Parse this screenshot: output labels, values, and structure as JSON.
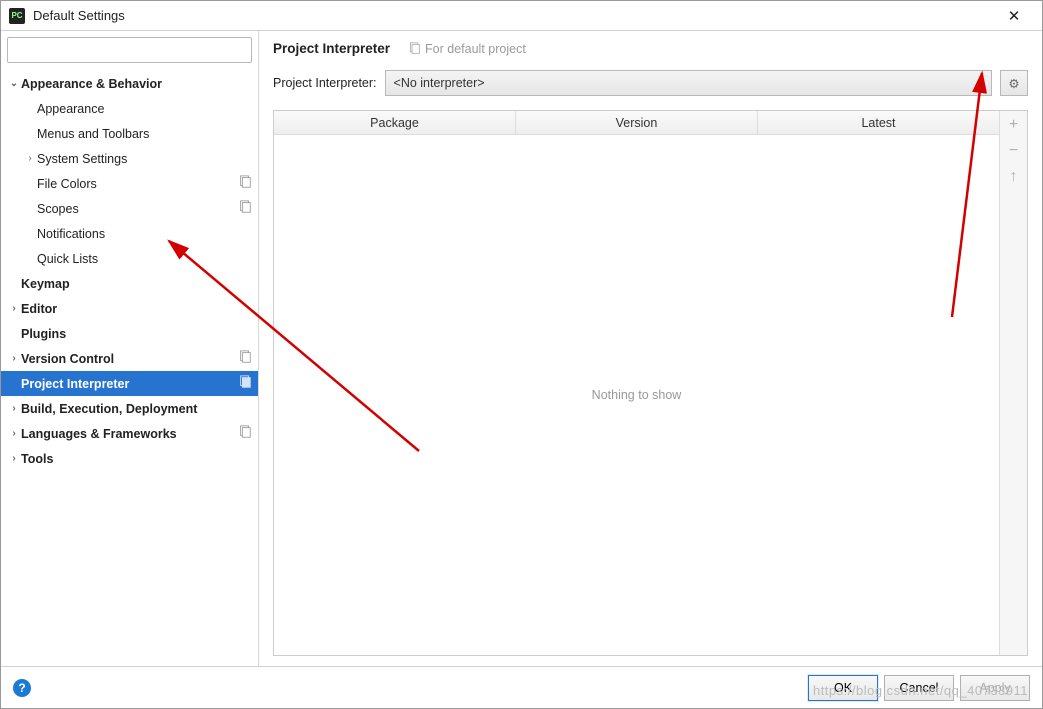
{
  "window": {
    "title": "Default Settings",
    "app_icon_text": "PC"
  },
  "search": {
    "placeholder": ""
  },
  "tree": [
    {
      "label": "Appearance & Behavior",
      "indent": 1,
      "bold": true,
      "chev": "open"
    },
    {
      "label": "Appearance",
      "indent": 2
    },
    {
      "label": "Menus and Toolbars",
      "indent": 2
    },
    {
      "label": "System Settings",
      "indent": 2,
      "chev": "closed"
    },
    {
      "label": "File Colors",
      "indent": 2,
      "copy": true
    },
    {
      "label": "Scopes",
      "indent": 2,
      "copy": true
    },
    {
      "label": "Notifications",
      "indent": 2
    },
    {
      "label": "Quick Lists",
      "indent": 2
    },
    {
      "label": "Keymap",
      "indent": 1,
      "bold": true
    },
    {
      "label": "Editor",
      "indent": 1,
      "bold": true,
      "chev": "closed"
    },
    {
      "label": "Plugins",
      "indent": 1,
      "bold": true
    },
    {
      "label": "Version Control",
      "indent": 1,
      "bold": true,
      "chev": "closed",
      "copy": true
    },
    {
      "label": "Project Interpreter",
      "indent": 1,
      "bold": true,
      "selected": true,
      "copy": true
    },
    {
      "label": "Build, Execution, Deployment",
      "indent": 1,
      "bold": true,
      "chev": "closed"
    },
    {
      "label": "Languages & Frameworks",
      "indent": 1,
      "bold": true,
      "chev": "closed",
      "copy": true
    },
    {
      "label": "Tools",
      "indent": 1,
      "bold": true,
      "chev": "closed"
    }
  ],
  "main": {
    "title": "Project Interpreter",
    "subtitle": "For default project",
    "interp_label": "Project Interpreter:",
    "interp_value": "<No interpreter>",
    "columns": {
      "c1": "Package",
      "c2": "Version",
      "c3": "Latest"
    },
    "empty_text": "Nothing to show"
  },
  "buttons": {
    "ok": "OK",
    "cancel": "Cancel",
    "apply": "Apply"
  },
  "watermark": "https://blog.csdn.net/qq_40733911"
}
